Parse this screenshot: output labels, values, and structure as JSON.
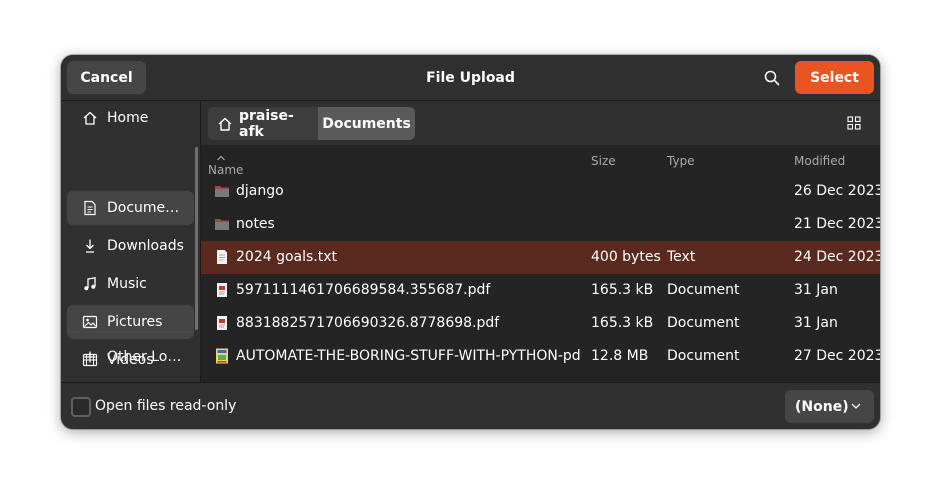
{
  "header": {
    "cancel_label": "Cancel",
    "title": "File Upload",
    "search_icon": "search-icon",
    "select_label": "Select",
    "accent_color": "#e95420"
  },
  "sidebar": {
    "items": [
      {
        "label": "Home",
        "icon": "home-icon"
      },
      {
        "label": "Docume…",
        "icon": "document-icon"
      },
      {
        "label": "Downloads",
        "icon": "download-icon"
      },
      {
        "label": "Music",
        "icon": "music-icon"
      },
      {
        "label": "Pictures",
        "icon": "picture-icon"
      },
      {
        "label": "Videos",
        "icon": "video-icon"
      }
    ],
    "other_locations": "Other Lo…"
  },
  "pathbar": {
    "home_label": "praise-afk",
    "current_label": "Documents",
    "view_toggle_icon": "grid-view-icon"
  },
  "columns": {
    "name": "Name",
    "size": "Size",
    "type": "Type",
    "modified": "Modified"
  },
  "files": [
    {
      "name": "django",
      "size": "",
      "type": "",
      "modified": "26 Dec 2023",
      "kind": "folder"
    },
    {
      "name": "notes",
      "size": "",
      "type": "",
      "modified": "21 Dec 2023",
      "kind": "folder"
    },
    {
      "name": "2024 goals.txt",
      "size": "400 bytes",
      "type": "Text",
      "modified": "24 Dec 2023",
      "kind": "text"
    },
    {
      "name": "5971111461706689584.355687.pdf",
      "size": "165.3 kB",
      "type": "Document",
      "modified": "31 Jan",
      "kind": "pdf"
    },
    {
      "name": "8831882571706690326.8778698.pdf",
      "size": "165.3 kB",
      "type": "Document",
      "modified": "31 Jan",
      "kind": "pdf"
    },
    {
      "name": "AUTOMATE-THE-BORING-STUFF-WITH-PYTHON-pdf-",
      "size": "12.8 MB",
      "type": "Document",
      "modified": "27 Dec 2023",
      "kind": "pdf-cover"
    }
  ],
  "footer": {
    "readonly_label": "Open files read-only",
    "filter_value": "(None)"
  }
}
